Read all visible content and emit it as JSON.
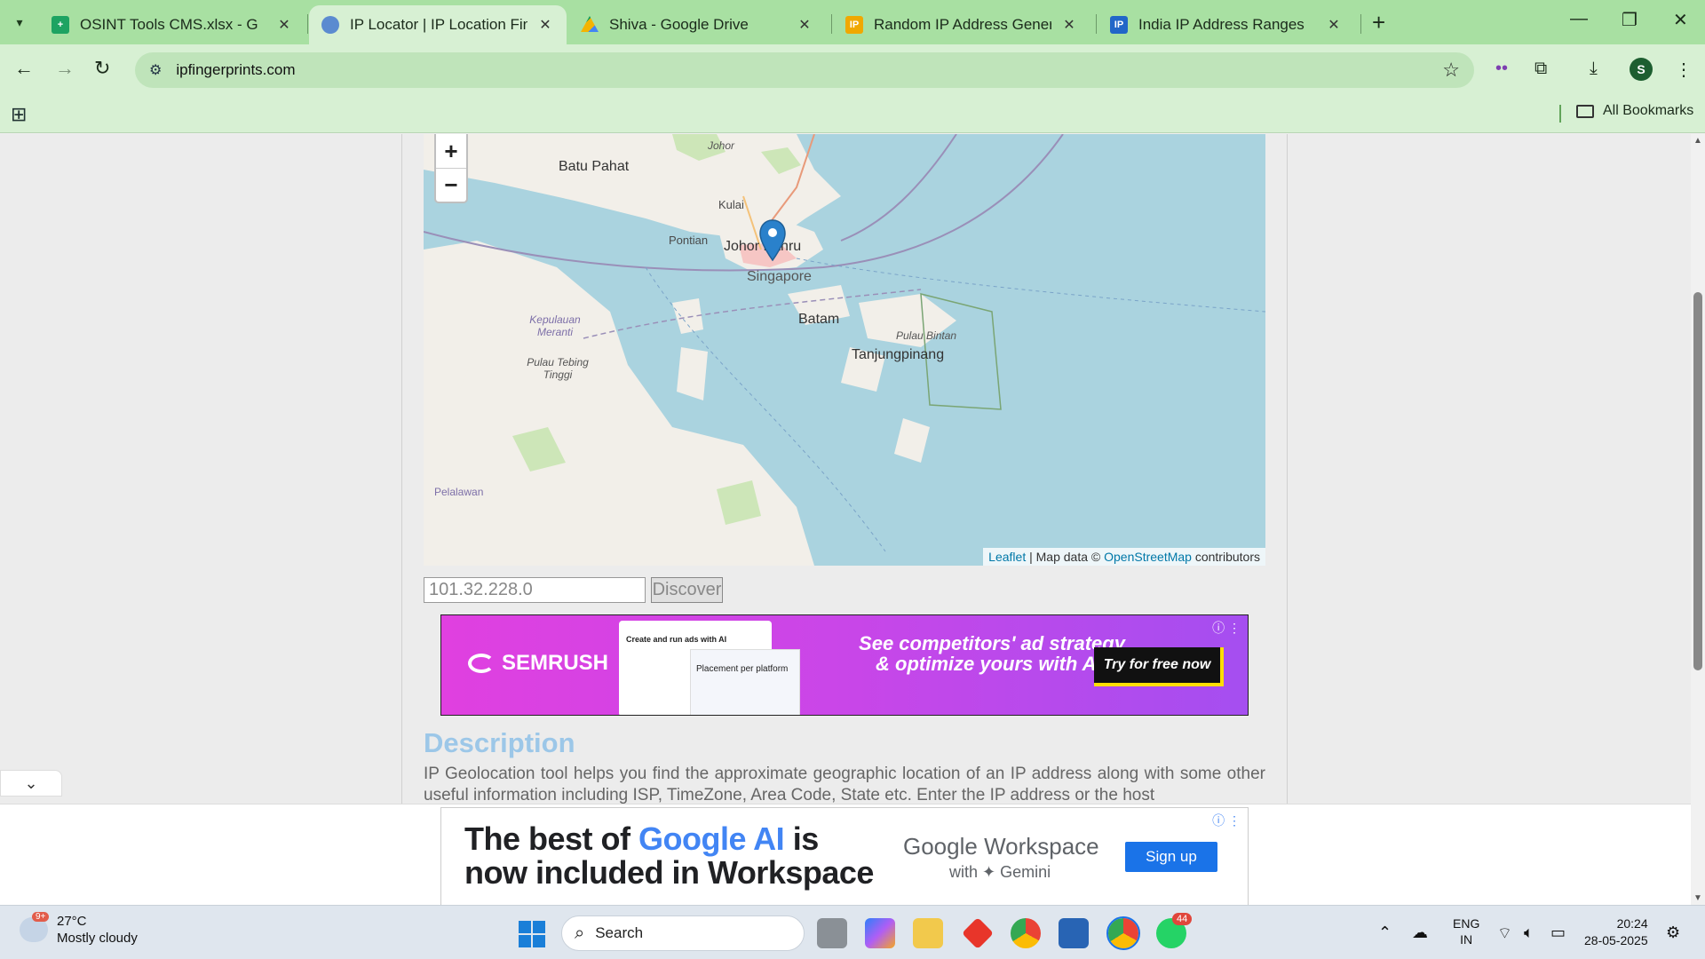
{
  "tabs": [
    {
      "title": "OSINT Tools CMS.xlsx - Google",
      "favicon": "sheets-icon",
      "color": "#1ea362",
      "active": false
    },
    {
      "title": "IP Locator | IP Location Finder |",
      "favicon": "globe-icon",
      "color": "#5b8bd0",
      "active": true
    },
    {
      "title": "Shiva - Google Drive",
      "favicon": "drive-icon",
      "color": "#f4b400",
      "active": false
    },
    {
      "title": "Random IP Address Generator,",
      "favicon": "ip-icon",
      "color": "#f0a800",
      "active": false
    },
    {
      "title": "India IP Address Ranges",
      "favicon": "ip-icon",
      "color": "#2166c8",
      "active": false
    }
  ],
  "toolbar": {
    "url": "ipfingerprints.com",
    "profile_initial": "S"
  },
  "bookmarks": {
    "all_label": "All Bookmarks"
  },
  "map": {
    "labels": {
      "batu_pahat": "Batu Pahat",
      "johor": "Johor",
      "kulai": "Kulai",
      "pontian": "Pontian",
      "johor_bahru": "Johor Bahru",
      "singapore": "Singapore",
      "batam": "Batam",
      "pulau_bintan": "Pulau Bintan",
      "tanjungpinang": "Tanjungpinang",
      "kepulauan_meranti": "Kepulauan Meranti",
      "pulau_tebing_tinggi": "Pulau Tebing Tinggi",
      "pelalawan": "Pelalawan"
    },
    "zoom_in": "+",
    "zoom_out": "−",
    "attribution": {
      "leaflet": "Leaflet",
      "sep": " | Map data © ",
      "osm": "OpenStreetMap",
      "contrib": " contributors"
    }
  },
  "form": {
    "ip_value": "101.32.228.0",
    "discover_label": "Discover"
  },
  "ad1": {
    "brand": "SEMRUSH",
    "shot_title": "Create and run ads with AI",
    "shot2_title": "Placement per platform",
    "copy": "See competitors' ad strategy & optimize yours with AI!",
    "cta": "Try for free now"
  },
  "description": {
    "title": "Description",
    "text": "IP Geolocation tool helps you find the approximate geographic location of an IP address along with some other useful information including ISP, TimeZone, Area Code, State etc. Enter the IP address or the host"
  },
  "ad2": {
    "headline_a": "The best of ",
    "headline_hl": "Google AI",
    "headline_b": " is",
    "headline_line2": "now included in Workspace",
    "brand": "Google Workspace",
    "gemini": "with ✦ Gemini",
    "cta": "Sign up"
  },
  "taskbar": {
    "weather_temp": "27°C",
    "weather_desc": "Mostly cloudy",
    "weather_badge": "9+",
    "search_label": "Search",
    "whatsapp_badge": "44",
    "lang_top": "ENG",
    "lang_bottom": "IN",
    "time": "20:24",
    "date": "28-05-2025"
  }
}
